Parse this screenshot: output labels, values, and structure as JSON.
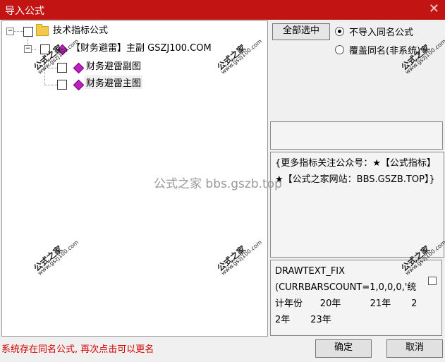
{
  "window": {
    "title": "导入公式",
    "close_glyph": "✕"
  },
  "tree": {
    "root_label": "技术指标公式",
    "group_label": "【财务避雷】主副 GSZJ100.COM",
    "items": [
      {
        "label": "财务避雷副图"
      },
      {
        "label": "财务避雷主图"
      }
    ]
  },
  "options": {
    "select_all_label": "全部选中",
    "radio_no_import_label": "不导入同名公式",
    "radio_overwrite_label": "覆盖同名(非系统)"
  },
  "description_text": "{更多指标关注公众号：★【公式指标】★【公式之家网站：BBS.GSZB.TOP】}",
  "code_text": "DRAWTEXT_FIX\n(CURRBARSCOUNT=1,0,0,0,'统计年份      20年          21年       22年       23年",
  "watermarks": {
    "center": "公式之家 bbs.gszb.top",
    "stamp_title": "公式之家",
    "stamp_url": "www.gszj100.com"
  },
  "status_message": "系统存在同名公式, 再次点击可以更名",
  "buttons": {
    "ok_label": "确定",
    "cancel_label": "取消"
  }
}
